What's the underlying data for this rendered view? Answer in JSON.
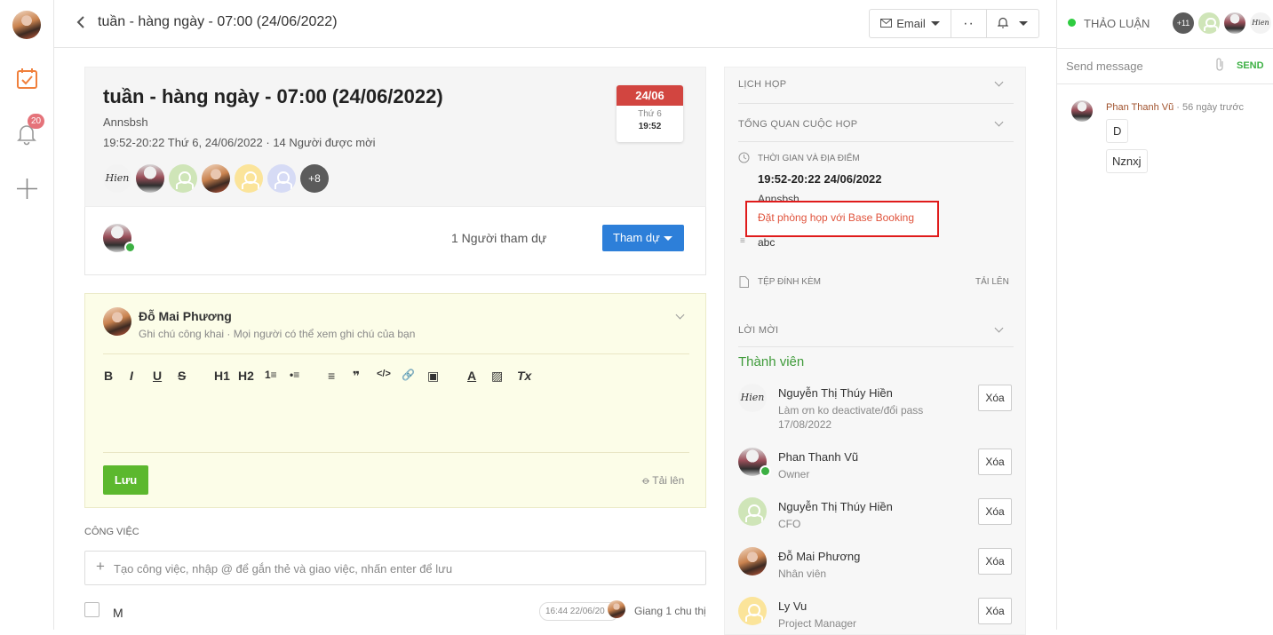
{
  "header": {
    "title": "tuần - hàng ngày - 07:00 (24/06/2022)",
    "email_label": "Email",
    "discussion_label": "THẢO LUẬN",
    "extra_count": "+11"
  },
  "rail": {
    "notification_count": "20"
  },
  "event": {
    "title": "tuần - hàng ngày - 07:00 (24/06/2022)",
    "organizer": "Annsbsh",
    "time_line": "19:52-20:22 Thứ 6, 24/06/2022 · 14 Người được mời",
    "more_invitees": "+8",
    "date_badge": {
      "date": "24/06",
      "weekday": "Thứ 6",
      "time": "19:52"
    },
    "hien_signature": "Hien"
  },
  "attendance": {
    "count_label": "1 Người tham dự",
    "join_button": "Tham dự"
  },
  "note": {
    "author": "Đỗ Mai Phương",
    "hint": "Ghi chú công khai · Mọi người có thể xem ghi chú của bạn",
    "save_button": "Lưu",
    "upload_label": "Tải lên",
    "toolbar": [
      "B",
      "I",
      "U",
      "S",
      "H1",
      "H2",
      "1≡",
      "•≡",
      "≡",
      "❞",
      "</>",
      "🔗",
      "▣",
      "A",
      "▨",
      "Tx"
    ]
  },
  "tasks": {
    "section_label": "CÔNG VIỆC",
    "input_placeholder": "Tạo công việc, nhập @ để gắn thẻ và giao việc, nhấn enter để lưu",
    "items": [
      {
        "title": "M",
        "timestamp": "16:44 22/06/20",
        "assignee_note": "Giang 1 chu thị"
      }
    ]
  },
  "info": {
    "schedule_label": "LỊCH HỌP",
    "overview_label": "TỔNG QUAN CUỘC HỌP",
    "time_place_label": "THỜI GIAN VÀ ĐỊA ĐIỂM",
    "time_value": "19:52-20:22 24/06/2022",
    "location": "Annsbsh",
    "booking_link": "Đặt phòng họp với Base Booking",
    "description": "abc",
    "attachments_label": "TỆP ĐÍNH KÈM",
    "upload_label": "TẢI LÊN",
    "invite_label": "LỜI MỜI",
    "members_label": "Thành viên",
    "delete_label": "Xóa",
    "members": [
      {
        "name": "Nguyễn Thị Thúy Hiền",
        "role": "Làm ơn ko deactivate/đổi pass 17/08/2022"
      },
      {
        "name": "Phan Thanh Vũ",
        "role": "Owner"
      },
      {
        "name": "Nguyễn Thị Thúy Hiền",
        "role": "CFO"
      },
      {
        "name": "Đỗ Mai Phương",
        "role": "Nhân viên"
      },
      {
        "name": "Ly Vu",
        "role": "Project Manager"
      }
    ]
  },
  "chat": {
    "placeholder": "Send message",
    "send_label": "SEND",
    "messages": [
      {
        "author": "Phan Thanh Vũ",
        "time": "56 ngày trước",
        "bubbles": [
          "D",
          "Nznxj"
        ]
      }
    ]
  },
  "colors": {
    "accent_orange": "#f0803c",
    "primary_blue": "#2d7fd9",
    "save_green": "#5cb82e",
    "link_red": "#e0533c",
    "highlight_box": "#e01b1b",
    "members_green": "#3f9b3a"
  }
}
